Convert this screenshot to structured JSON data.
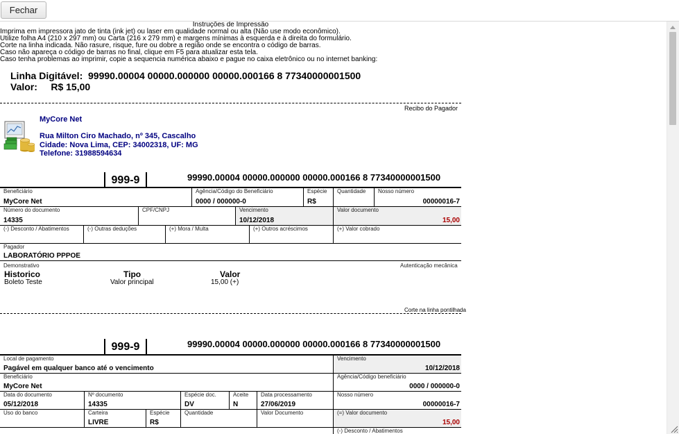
{
  "topbar": {
    "close_label": "Fechar"
  },
  "instructions": {
    "title": "Instruções de Impressão",
    "lines": [
      "Imprima em impressora jato de tinta (ink jet) ou laser em qualidade normal ou alta (Não use modo econômico).",
      "Utilize folha A4 (210 x 297 mm) ou Carta (216 x 279 mm) e margens mínimas à esquerda e à direita do formulário.",
      "Corte na linha indicada. Não rasure, risque, fure ou dobre a região onde se encontra o código de barras.",
      "Caso não apareça o código de barras no final, clique em F5 para atualizar esta tela.",
      "Caso tenha problemas ao imprimir, copie a sequencia numérica abaixo e pague no caixa eletrônico ou no internet banking:"
    ]
  },
  "summary": {
    "linha_label": "Linha Digitável:",
    "linha_value": "99990.00004 00000.000000 00000.000166 8 77340000001500",
    "valor_label": "Valor:",
    "valor_value": "R$ 15,00"
  },
  "recibo_label": "Recibo do Pagador",
  "company": {
    "name": "MyCore Net",
    "address": "Rua Milton Ciro Machado, nº 345, Cascalho",
    "city": "Cidade: Nova Lima, CEP: 34002318, UF: MG",
    "phone": "Telefone: 31988594634"
  },
  "receipt": {
    "bank_code": "999-9",
    "linha": "99990.00004 00000.000000 00000.000166 8 77340000001500",
    "labels": {
      "beneficiario": "Beneficiário",
      "agencia": "Agência/Código do Beneficiário",
      "especie": "Espécie",
      "quantidade": "Quantidade",
      "nosso_numero": "Nosso número",
      "numero_documento": "Número do documento",
      "cpf_cnpj": "CPF/CNPJ",
      "vencimento": "Vencimento",
      "valor_documento": "Valor documento",
      "desconto": "(-) Desconto / Abatimentos",
      "outras_deducoes": "(-) Outras deduções",
      "mora": "(+) Mora / Multa",
      "outros_acrescimos": "(+) Outros acréscimos",
      "valor_cobrado": "(+) Valor cobrado",
      "pagador": "Pagador",
      "demonstrativo": "Demonstrativo",
      "autenticacao": "Autenticação mecânica"
    },
    "values": {
      "beneficiario": "MyCore Net",
      "agencia": "0000 / 000000-0",
      "especie": "R$",
      "nosso_numero": "00000016-7",
      "numero_documento": "14335",
      "vencimento": "10/12/2018",
      "valor_documento": "15,00",
      "pagador": "LABORATÓRIO PPPOE"
    },
    "demonstrativo": {
      "headers": [
        "Historico",
        "Tipo",
        "Valor"
      ],
      "rows": [
        [
          "Boleto Teste",
          "Valor principal",
          "15,00 (+)"
        ]
      ]
    },
    "corte_label": "Corte na linha pontilhada"
  },
  "slip": {
    "bank_code": "999-9",
    "linha": "99990.00004 00000.000000 00000.000166 8 77340000001500",
    "labels": {
      "local_pagamento": "Local de pagamento",
      "vencimento": "Vencimento",
      "beneficiario": "Beneficiário",
      "agencia": "Agência/Código beneficiário",
      "data_documento": "Data do documento",
      "n_documento": "Nº documento",
      "especie_doc": "Espécie doc.",
      "aceite": "Aceite",
      "data_processamento": "Data processamento",
      "nosso_numero": "Nosso número",
      "uso_banco": "Uso do banco",
      "carteira": "Carteira",
      "especie": "Espécie",
      "quantidade": "Quantidade",
      "valor_documento": "Valor Documento",
      "valor_documento2": "(=) Valor documento",
      "desconto": "(-) Desconto / Abatimentos"
    },
    "values": {
      "local_pagamento": "Pagável em qualquer banco até o vencimento",
      "vencimento": "10/12/2018",
      "beneficiario": "MyCore Net",
      "agencia": "0000 / 000000-0",
      "data_documento": "05/12/2018",
      "n_documento": "14335",
      "especie_doc": "DV",
      "aceite": "N",
      "data_processamento": "27/06/2019",
      "nosso_numero": "00000016-7",
      "carteira": "LIVRE",
      "especie": "R$",
      "valor_documento": "15,00"
    }
  },
  "colors": {
    "company": "#000080",
    "value_red": "#a00000"
  }
}
